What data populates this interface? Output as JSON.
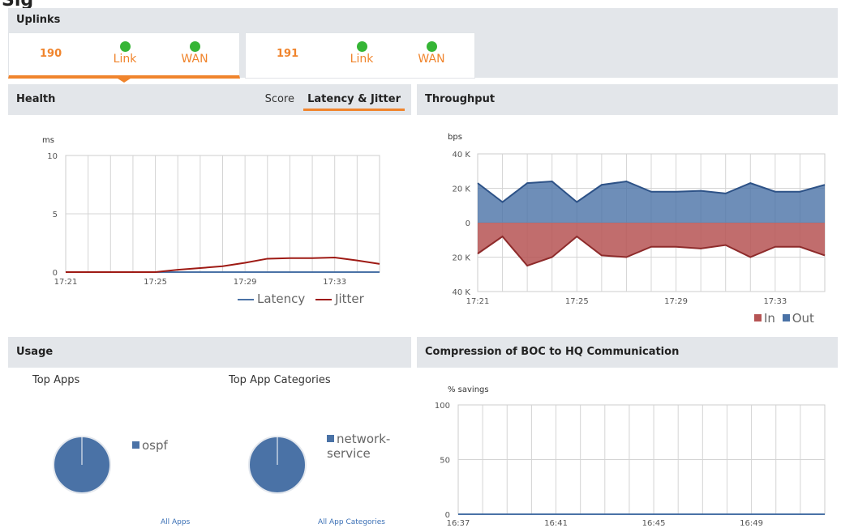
{
  "partial_heading": "Sig",
  "uplinks": {
    "title": "Uplinks",
    "cards": [
      {
        "id": "190",
        "link_label": "Link",
        "wan_label": "WAN",
        "link_status": "up",
        "wan_status": "up",
        "active": true
      },
      {
        "id": "191",
        "link_label": "Link",
        "wan_label": "WAN",
        "link_status": "up",
        "wan_status": "up",
        "active": false
      }
    ]
  },
  "health": {
    "title": "Health",
    "tabs": [
      "Score",
      "Latency & Jitter"
    ],
    "selected_tab": "Latency & Jitter",
    "unit": "ms",
    "legend": [
      "Latency",
      "Jitter"
    ]
  },
  "throughput": {
    "title": "Throughput",
    "unit": "bps",
    "legend": [
      "In",
      "Out"
    ]
  },
  "usage": {
    "title": "Usage",
    "top_apps_title": "Top Apps",
    "top_app_categories_title": "Top App Categories",
    "apps_legend": "ospf",
    "categories_legend": "network-service",
    "all_apps_link": "All Apps",
    "all_categories_link": "All App Categories"
  },
  "compression": {
    "title": "Compression of BOC to HQ Communication",
    "unit": "% savings"
  },
  "colors": {
    "accent": "#f0842c",
    "status_green": "#35b535",
    "latency": "#4a72a6",
    "jitter": "#9e1a14",
    "in": "#b65454",
    "out": "#4a72a6",
    "panel_header": "#e3e6ea"
  },
  "chart_data": [
    {
      "id": "latency-jitter",
      "type": "line",
      "ylabel": "ms",
      "ylim": [
        0,
        10
      ],
      "yticks": [
        "10",
        "5",
        "0"
      ],
      "xticks": [
        "17:21",
        "17:25",
        "17:29",
        "17:33"
      ],
      "grid": true,
      "legend_placement": "bottom-right",
      "series": [
        {
          "name": "Latency",
          "values": [
            0,
            0,
            0,
            0,
            0,
            0,
            0,
            0,
            0,
            0,
            0,
            0,
            0,
            0,
            0
          ]
        },
        {
          "name": "Jitter",
          "values": [
            0,
            0,
            0,
            0,
            0,
            0.2,
            0.35,
            0.5,
            0.8,
            1.15,
            1.2,
            1.2,
            1.25,
            1.0,
            0.7
          ]
        }
      ]
    },
    {
      "id": "throughput",
      "type": "area",
      "ylabel": "bps",
      "ylim": [
        -40000,
        40000
      ],
      "yticks": [
        "40 K",
        "20 K",
        "0",
        "20 K",
        "40 K"
      ],
      "xticks": [
        "17:21",
        "17:25",
        "17:29",
        "17:33"
      ],
      "grid": true,
      "legend_placement": "bottom-right",
      "series": [
        {
          "name": "Out",
          "values": [
            23000,
            12000,
            23000,
            24000,
            12000,
            22000,
            24000,
            18000,
            18000,
            18500,
            17000,
            23000,
            18000,
            18000,
            22000
          ]
        },
        {
          "name": "In",
          "values": [
            18000,
            8000,
            25000,
            20000,
            8000,
            19000,
            20000,
            14000,
            14000,
            15000,
            13000,
            20000,
            14000,
            14000,
            19000
          ]
        }
      ]
    },
    {
      "id": "top-apps",
      "type": "pie",
      "series": [
        {
          "name": "ospf",
          "values": [
            100
          ]
        }
      ]
    },
    {
      "id": "top-app-categories",
      "type": "pie",
      "series": [
        {
          "name": "network-service",
          "values": [
            100
          ]
        }
      ]
    },
    {
      "id": "compression",
      "type": "line",
      "ylabel": "% savings",
      "ylim": [
        0,
        100
      ],
      "yticks": [
        "100",
        "50",
        "0"
      ],
      "xticks": [
        "16:37",
        "16:41",
        "16:45",
        "16:49"
      ],
      "grid": true,
      "series": [
        {
          "name": "",
          "values": [
            0,
            0,
            0,
            0,
            0,
            0,
            0,
            0,
            0,
            0,
            0,
            0,
            0,
            0,
            0
          ]
        }
      ]
    }
  ]
}
